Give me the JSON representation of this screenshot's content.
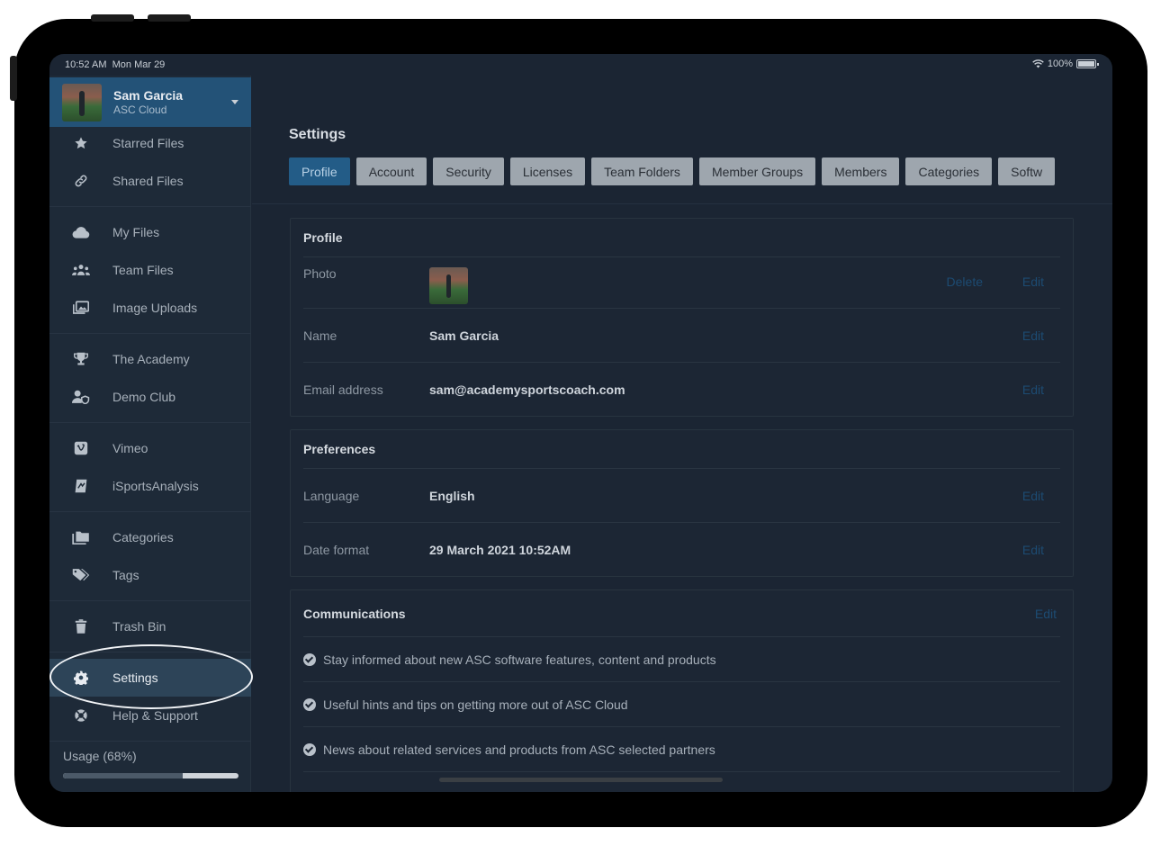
{
  "status": {
    "time": "10:52 AM",
    "date": "Mon Mar 29",
    "battery": "100%"
  },
  "account": {
    "name": "Sam Garcia",
    "subtitle": "ASC Cloud"
  },
  "sidebar": {
    "items": [
      {
        "label": "Starred Files",
        "icon": "star-icon"
      },
      {
        "label": "Shared Files",
        "icon": "link-icon"
      },
      {
        "label": "My Files",
        "icon": "cloud-icon"
      },
      {
        "label": "Team Files",
        "icon": "users-icon"
      },
      {
        "label": "Image Uploads",
        "icon": "image-icon"
      },
      {
        "label": "The Academy",
        "icon": "trophy-icon"
      },
      {
        "label": "Demo Club",
        "icon": "user-shield-icon"
      },
      {
        "label": "Vimeo",
        "icon": "vimeo-icon"
      },
      {
        "label": "iSportsAnalysis",
        "icon": "isports-icon"
      },
      {
        "label": "Categories",
        "icon": "folders-icon"
      },
      {
        "label": "Tags",
        "icon": "tags-icon"
      },
      {
        "label": "Trash Bin",
        "icon": "trash-icon"
      },
      {
        "label": "Settings",
        "icon": "gear-icon"
      },
      {
        "label": "Help & Support",
        "icon": "lifebuoy-icon"
      }
    ],
    "usage_label": "Usage (68%)",
    "usage_fraction": 0.68
  },
  "main": {
    "title": "Settings",
    "tabs": [
      "Profile",
      "Account",
      "Security",
      "Licenses",
      "Team Folders",
      "Member Groups",
      "Members",
      "Categories",
      "Softw"
    ],
    "active_tab": "Profile",
    "profile": {
      "heading": "Profile",
      "photo_label": "Photo",
      "delete_label": "Delete",
      "edit_label": "Edit",
      "name_label": "Name",
      "name_value": "Sam Garcia",
      "email_label": "Email address",
      "email_value": "sam@academysportscoach.com"
    },
    "preferences": {
      "heading": "Preferences",
      "language_label": "Language",
      "language_value": "English",
      "date_label": "Date format",
      "date_value": "29 March 2021 10:52AM",
      "edit_label": "Edit"
    },
    "communications": {
      "heading": "Communications",
      "edit_label": "Edit",
      "items": [
        "Stay informed about new ASC software features, content and products",
        "Useful hints and tips on getting more out of ASC Cloud",
        "News about related services and products from ASC selected partners"
      ]
    }
  },
  "colors": {
    "accent": "#235c87",
    "link": "#1c4b72",
    "background": "#1b2533"
  }
}
